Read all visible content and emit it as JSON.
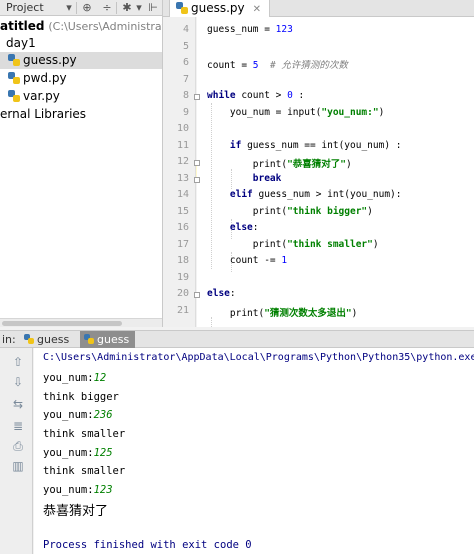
{
  "project_pane": {
    "toolbar": {
      "title": "Project",
      "toolbar_icons": [
        "sync-icon",
        "split-icon",
        "gear-icon",
        "hide-icon"
      ]
    },
    "root_label": "atitled",
    "root_path": "(C:\\Users\\Administrator\\Py",
    "items": [
      {
        "label": "day1",
        "type": "folder"
      },
      {
        "label": "guess.py",
        "type": "python-file",
        "selected": true
      },
      {
        "label": "pwd.py",
        "type": "python-file"
      },
      {
        "label": "var.py",
        "type": "python-file"
      },
      {
        "label": "ernal Libraries",
        "type": "library"
      }
    ]
  },
  "editor": {
    "tab_label": "guess.py",
    "current_line": 13,
    "lines": [
      {
        "num": "4",
        "text": "guess_num = 123"
      },
      {
        "num": "5",
        "text": ""
      },
      {
        "num": "6",
        "text": "count = 5  # 允许猜测的次数"
      },
      {
        "num": "7",
        "text": ""
      },
      {
        "num": "8",
        "text": "while count > 0 :"
      },
      {
        "num": "9",
        "text": "    you_num = input(\"you_num:\")"
      },
      {
        "num": "10",
        "text": ""
      },
      {
        "num": "11",
        "text": "    if guess_num == int(you_num) :"
      },
      {
        "num": "12",
        "text": "        print(\"恭喜猜对了\")"
      },
      {
        "num": "13",
        "text": "        break"
      },
      {
        "num": "14",
        "text": "    elif guess_num > int(you_num):"
      },
      {
        "num": "15",
        "text": "        print(\"think bigger\")"
      },
      {
        "num": "16",
        "text": "    else:"
      },
      {
        "num": "17",
        "text": "        print(\"think smaller\")"
      },
      {
        "num": "18",
        "text": "    count -= 1"
      },
      {
        "num": "19",
        "text": ""
      },
      {
        "num": "20",
        "text": "else:"
      },
      {
        "num": "21",
        "text": "    print(\"猜测次数太多退出\")"
      }
    ]
  },
  "run_panel": {
    "label": "in:",
    "tabs": [
      {
        "label": "guess",
        "active": false
      },
      {
        "label": "guess",
        "active": true
      }
    ],
    "toolbar_icons": [
      "up-arrow-icon",
      "down-arrow-icon",
      "soft-wrap-icon",
      "scroll-to-end-icon",
      "print-icon",
      "clear-all-icon"
    ],
    "console": {
      "command": "C:\\Users\\Administrator\\AppData\\Local\\Programs\\Python\\Python35\\python.exe",
      "entries": [
        {
          "prompt": "you_num:",
          "input": "12"
        },
        {
          "output": "think bigger"
        },
        {
          "prompt": "you_num:",
          "input": "236"
        },
        {
          "output": "think smaller"
        },
        {
          "prompt": "you_num:",
          "input": "125"
        },
        {
          "output": "think smaller"
        },
        {
          "prompt": "you_num:",
          "input": "123"
        },
        {
          "output": "恭喜猜对了"
        }
      ],
      "exit_message": "Process finished with exit code 0"
    }
  },
  "colors": {
    "keyword": "#000080",
    "number": "#0000ff",
    "string": "#008000",
    "comment": "#808080",
    "caret_line": "#fff9cc",
    "user_input": "#008000",
    "active_tab": "#8e8e8e"
  }
}
